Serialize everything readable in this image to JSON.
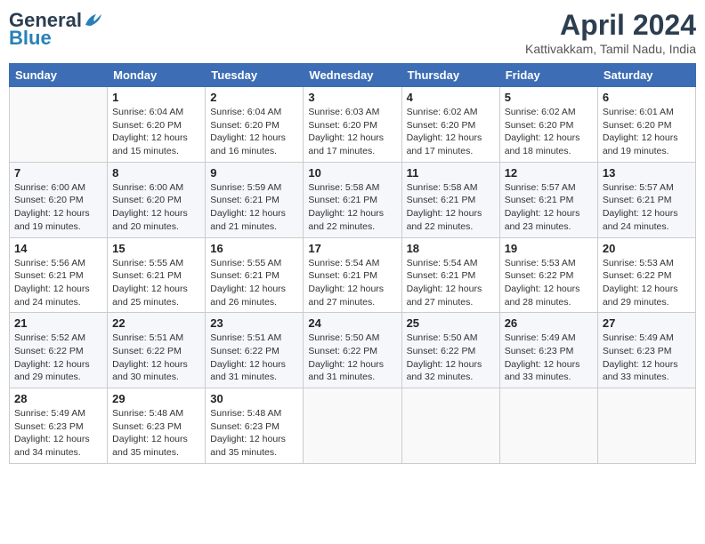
{
  "header": {
    "logo_general": "General",
    "logo_blue": "Blue",
    "month_title": "April 2024",
    "location": "Kattivakkam, Tamil Nadu, India"
  },
  "weekdays": [
    "Sunday",
    "Monday",
    "Tuesday",
    "Wednesday",
    "Thursday",
    "Friday",
    "Saturday"
  ],
  "weeks": [
    [
      {
        "day": "",
        "info": ""
      },
      {
        "day": "1",
        "info": "Sunrise: 6:04 AM\nSunset: 6:20 PM\nDaylight: 12 hours\nand 15 minutes."
      },
      {
        "day": "2",
        "info": "Sunrise: 6:04 AM\nSunset: 6:20 PM\nDaylight: 12 hours\nand 16 minutes."
      },
      {
        "day": "3",
        "info": "Sunrise: 6:03 AM\nSunset: 6:20 PM\nDaylight: 12 hours\nand 17 minutes."
      },
      {
        "day": "4",
        "info": "Sunrise: 6:02 AM\nSunset: 6:20 PM\nDaylight: 12 hours\nand 17 minutes."
      },
      {
        "day": "5",
        "info": "Sunrise: 6:02 AM\nSunset: 6:20 PM\nDaylight: 12 hours\nand 18 minutes."
      },
      {
        "day": "6",
        "info": "Sunrise: 6:01 AM\nSunset: 6:20 PM\nDaylight: 12 hours\nand 19 minutes."
      }
    ],
    [
      {
        "day": "7",
        "info": "Sunrise: 6:00 AM\nSunset: 6:20 PM\nDaylight: 12 hours\nand 19 minutes."
      },
      {
        "day": "8",
        "info": "Sunrise: 6:00 AM\nSunset: 6:20 PM\nDaylight: 12 hours\nand 20 minutes."
      },
      {
        "day": "9",
        "info": "Sunrise: 5:59 AM\nSunset: 6:21 PM\nDaylight: 12 hours\nand 21 minutes."
      },
      {
        "day": "10",
        "info": "Sunrise: 5:58 AM\nSunset: 6:21 PM\nDaylight: 12 hours\nand 22 minutes."
      },
      {
        "day": "11",
        "info": "Sunrise: 5:58 AM\nSunset: 6:21 PM\nDaylight: 12 hours\nand 22 minutes."
      },
      {
        "day": "12",
        "info": "Sunrise: 5:57 AM\nSunset: 6:21 PM\nDaylight: 12 hours\nand 23 minutes."
      },
      {
        "day": "13",
        "info": "Sunrise: 5:57 AM\nSunset: 6:21 PM\nDaylight: 12 hours\nand 24 minutes."
      }
    ],
    [
      {
        "day": "14",
        "info": "Sunrise: 5:56 AM\nSunset: 6:21 PM\nDaylight: 12 hours\nand 24 minutes."
      },
      {
        "day": "15",
        "info": "Sunrise: 5:55 AM\nSunset: 6:21 PM\nDaylight: 12 hours\nand 25 minutes."
      },
      {
        "day": "16",
        "info": "Sunrise: 5:55 AM\nSunset: 6:21 PM\nDaylight: 12 hours\nand 26 minutes."
      },
      {
        "day": "17",
        "info": "Sunrise: 5:54 AM\nSunset: 6:21 PM\nDaylight: 12 hours\nand 27 minutes."
      },
      {
        "day": "18",
        "info": "Sunrise: 5:54 AM\nSunset: 6:21 PM\nDaylight: 12 hours\nand 27 minutes."
      },
      {
        "day": "19",
        "info": "Sunrise: 5:53 AM\nSunset: 6:22 PM\nDaylight: 12 hours\nand 28 minutes."
      },
      {
        "day": "20",
        "info": "Sunrise: 5:53 AM\nSunset: 6:22 PM\nDaylight: 12 hours\nand 29 minutes."
      }
    ],
    [
      {
        "day": "21",
        "info": "Sunrise: 5:52 AM\nSunset: 6:22 PM\nDaylight: 12 hours\nand 29 minutes."
      },
      {
        "day": "22",
        "info": "Sunrise: 5:51 AM\nSunset: 6:22 PM\nDaylight: 12 hours\nand 30 minutes."
      },
      {
        "day": "23",
        "info": "Sunrise: 5:51 AM\nSunset: 6:22 PM\nDaylight: 12 hours\nand 31 minutes."
      },
      {
        "day": "24",
        "info": "Sunrise: 5:50 AM\nSunset: 6:22 PM\nDaylight: 12 hours\nand 31 minutes."
      },
      {
        "day": "25",
        "info": "Sunrise: 5:50 AM\nSunset: 6:22 PM\nDaylight: 12 hours\nand 32 minutes."
      },
      {
        "day": "26",
        "info": "Sunrise: 5:49 AM\nSunset: 6:23 PM\nDaylight: 12 hours\nand 33 minutes."
      },
      {
        "day": "27",
        "info": "Sunrise: 5:49 AM\nSunset: 6:23 PM\nDaylight: 12 hours\nand 33 minutes."
      }
    ],
    [
      {
        "day": "28",
        "info": "Sunrise: 5:49 AM\nSunset: 6:23 PM\nDaylight: 12 hours\nand 34 minutes."
      },
      {
        "day": "29",
        "info": "Sunrise: 5:48 AM\nSunset: 6:23 PM\nDaylight: 12 hours\nand 35 minutes."
      },
      {
        "day": "30",
        "info": "Sunrise: 5:48 AM\nSunset: 6:23 PM\nDaylight: 12 hours\nand 35 minutes."
      },
      {
        "day": "",
        "info": ""
      },
      {
        "day": "",
        "info": ""
      },
      {
        "day": "",
        "info": ""
      },
      {
        "day": "",
        "info": ""
      }
    ]
  ]
}
